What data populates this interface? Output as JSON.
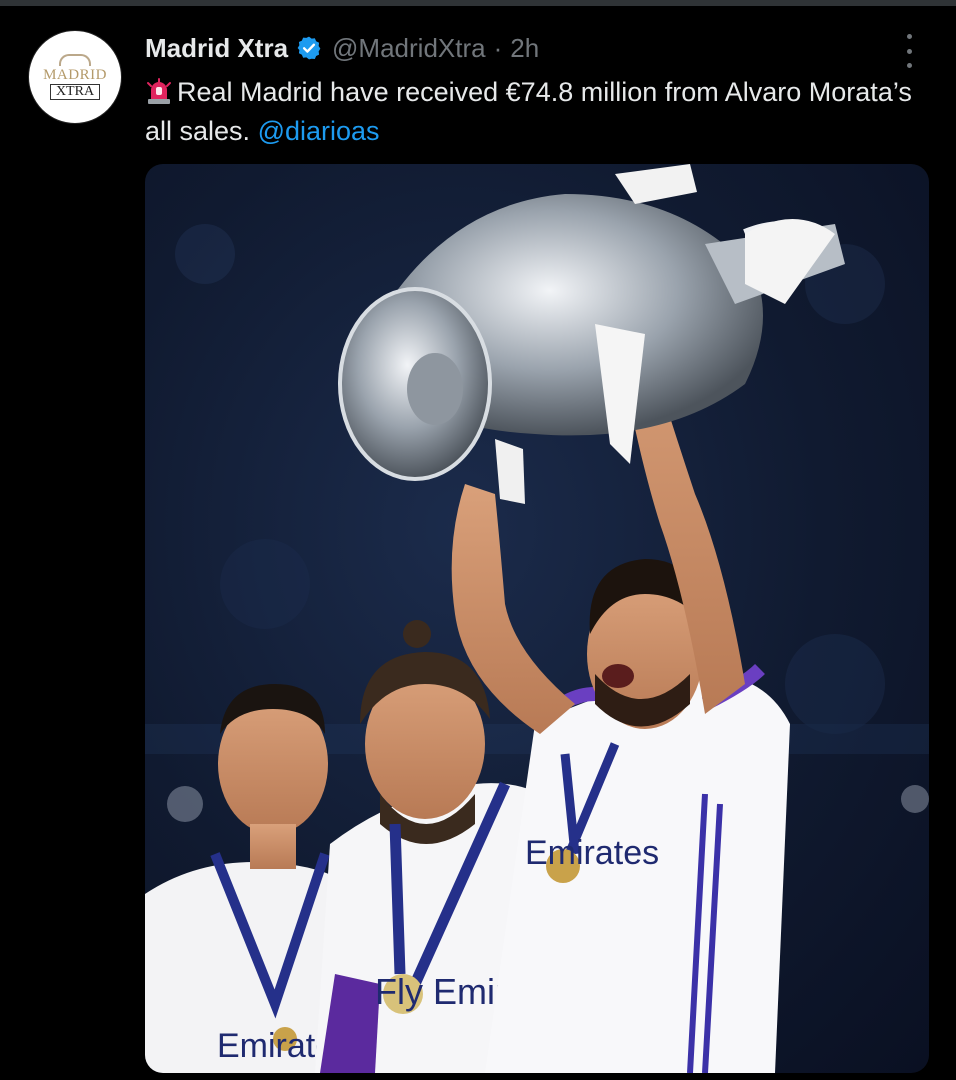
{
  "tweet": {
    "author_name": "Madrid Xtra",
    "handle": "@MadridXtra",
    "separator": "·",
    "time": "2h",
    "text_main": "Real Madrid have received €74.8 million from Alvaro Morata’s all sales.",
    "mention": "@diarioas",
    "avatar_line1": "MADRID",
    "avatar_line2": "XTRA"
  },
  "icons": {
    "verified": "verified-badge-icon",
    "menu": "more-options-icon",
    "siren": "police-siren-icon"
  },
  "photo": {
    "shirt_text_center": "Fly Emirates",
    "shirt_text_right": "Emirates",
    "shirt_text_left": "Emirates"
  },
  "colors": {
    "background": "#000000",
    "text": "#e7e9ea",
    "muted": "#71767b",
    "link": "#1d9bf0"
  }
}
